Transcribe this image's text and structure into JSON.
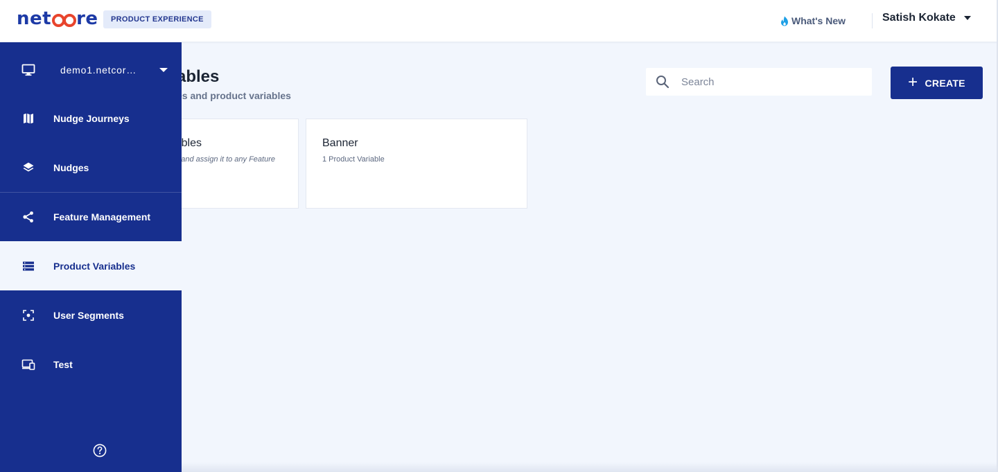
{
  "header": {
    "logo_text_prefix": "net",
    "logo_text_suffix": "re",
    "product_badge": "PRODUCT EXPERIENCE",
    "whats_new": "What's New",
    "user_name": "Satish Kokate"
  },
  "sidebar": {
    "project": "demo1.netcor…",
    "items": [
      {
        "label": "Nudge Journeys",
        "icon": "map-icon"
      },
      {
        "label": "Nudges",
        "icon": "layers-icon"
      },
      {
        "label": "Feature Management",
        "icon": "share-nodes-icon"
      },
      {
        "label": "Product Variables",
        "icon": "list-icon",
        "active": true
      },
      {
        "label": "User Segments",
        "icon": "focus-target-icon"
      },
      {
        "label": "Test",
        "icon": "devices-icon"
      }
    ]
  },
  "main": {
    "title_visible": "ables",
    "subtitle_visible": "es and product variables",
    "search_placeholder": "Search",
    "create_label": "CREATE",
    "cards": [
      {
        "title": "bles",
        "subtitle": "and assign it to any Feature"
      },
      {
        "title": "Banner",
        "subtitle": "1 Product Variable"
      }
    ]
  },
  "colors": {
    "brand_blue": "#172f8e",
    "logo_accent": "#e8442c",
    "background": "#f2f6fd",
    "whats_new_flame": "#1ea0e6"
  }
}
